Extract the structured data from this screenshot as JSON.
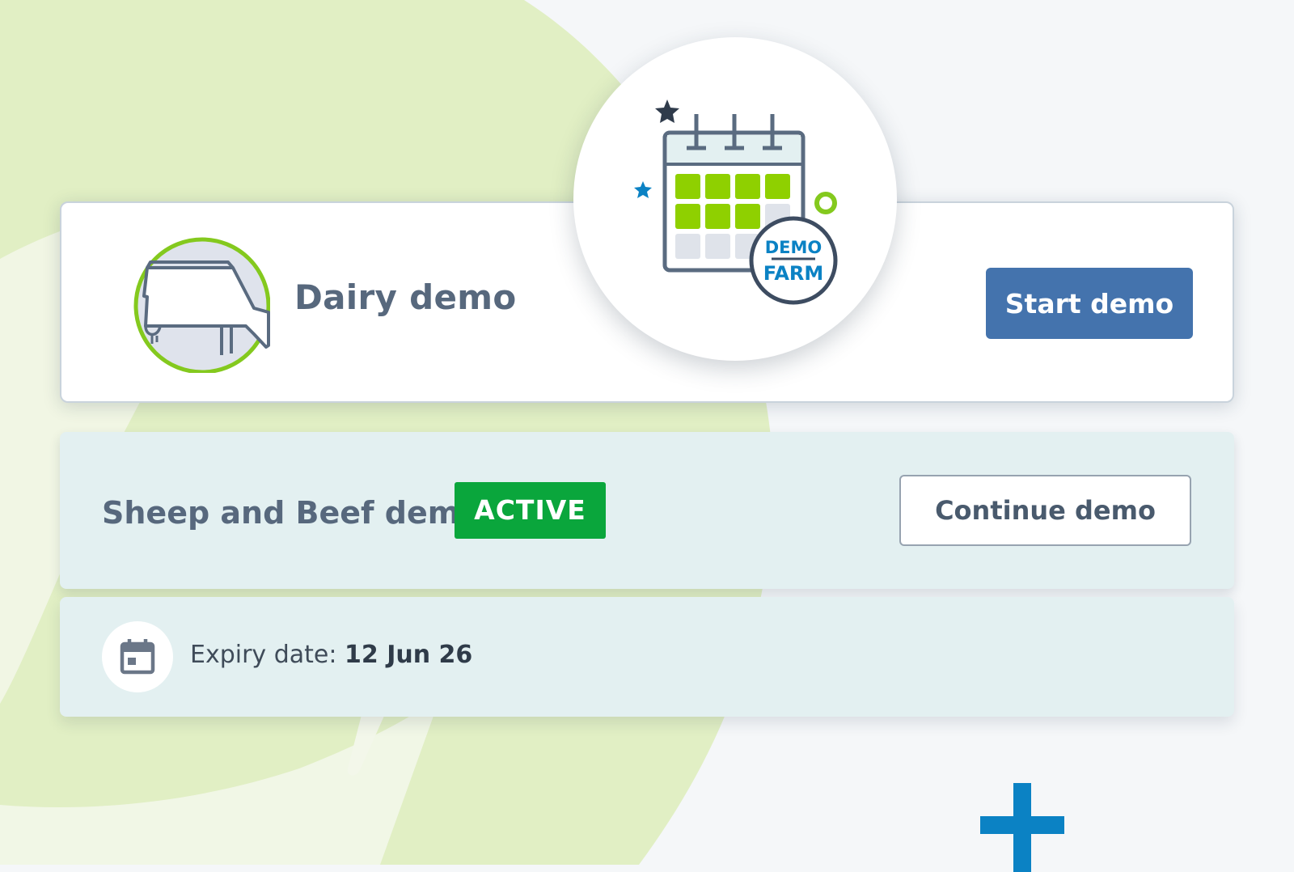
{
  "colors": {
    "background": "#f5f7f9",
    "leaf_green": "#e1efc4",
    "primary_blue": "#4473ad",
    "active_green": "#0aa63c",
    "accent_green": "#84c91e",
    "accent_blue": "#0b82c4",
    "text_slate": "#57687d",
    "tinted_card": "#e3f0f1"
  },
  "background": {
    "leaf_shape": "leaf-shape",
    "plus_icon": "plus-icon"
  },
  "illustration": {
    "icon": "calendar-icon",
    "badge_line1": "DEMO",
    "badge_line2": "FARM"
  },
  "dairy_card": {
    "icon": "cow-icon",
    "title": "Dairy demo",
    "button_label": "Start demo"
  },
  "sheep_card": {
    "title": "Sheep and Beef demo",
    "status_badge": "ACTIVE",
    "button_label": "Continue demo"
  },
  "expiry": {
    "icon": "calendar-icon",
    "label": "Expiry date:",
    "value": "12 Jun 26"
  }
}
